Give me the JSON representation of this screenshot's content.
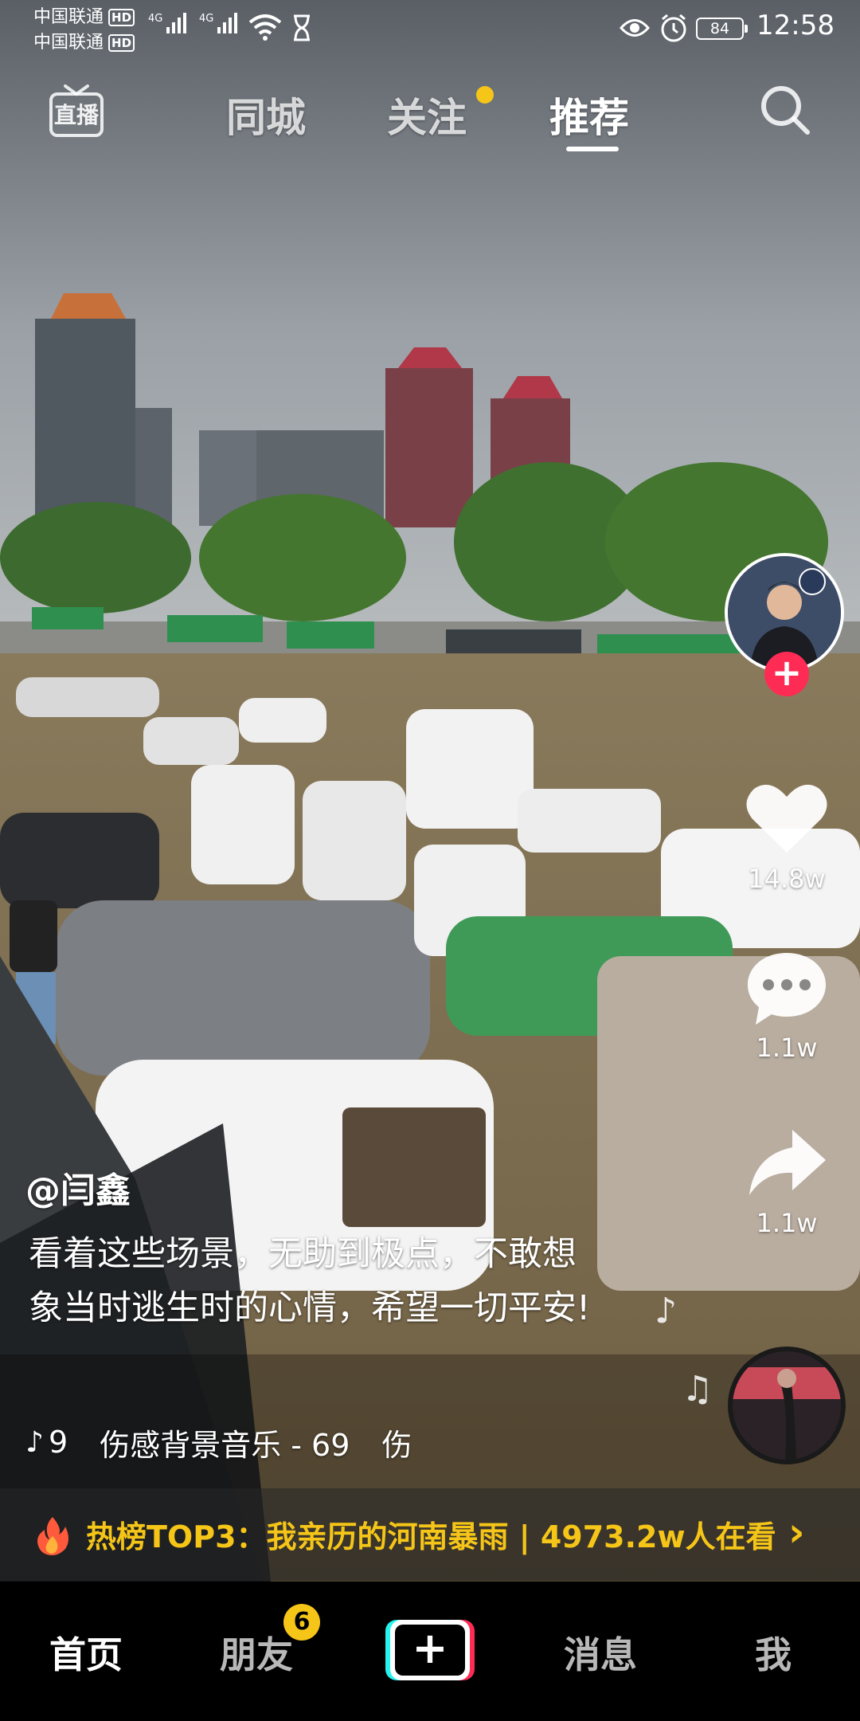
{
  "status_bar": {
    "carrier_1": "中国联通",
    "carrier_2": "中国联通",
    "hd_label": "HD",
    "network_1": "4G",
    "network_2": "4G",
    "battery": "84",
    "time": "12:58"
  },
  "top_nav": {
    "live_label": "直播",
    "tabs": [
      {
        "label": "同城",
        "active": false
      },
      {
        "label": "关注",
        "active": false,
        "has_dot": true
      },
      {
        "label": "推荐",
        "active": true
      }
    ]
  },
  "actions": {
    "likes": "14.8w",
    "comments": "1.1w",
    "shares": "1.1w"
  },
  "post": {
    "author": "@闫鑫",
    "description": "看着这些场景，无助到极点，不敢想象当时逃生时的心情，希望一切平安!",
    "music_prefix": "9",
    "music_title": "伤感背景音乐 - 69",
    "music_tail": "伤"
  },
  "hot_banner": {
    "text": "热榜TOP3：我亲历的河南暴雨 | 4973.2w人在看",
    "arrow": "›"
  },
  "bottom_tabs": {
    "home": "首页",
    "friends": "朋友",
    "friends_badge": "6",
    "add": "+",
    "messages": "消息",
    "me": "我"
  },
  "colors": {
    "accent_red": "#fe2c55",
    "accent_cyan": "#25f4ee",
    "hot_yellow": "#f5c518"
  },
  "icons": [
    "live-icon",
    "search-icon",
    "heart-icon",
    "comment-icon",
    "share-icon",
    "music-note-icon",
    "flame-icon",
    "chevron-right-icon",
    "tiktok-logo-icon"
  ]
}
